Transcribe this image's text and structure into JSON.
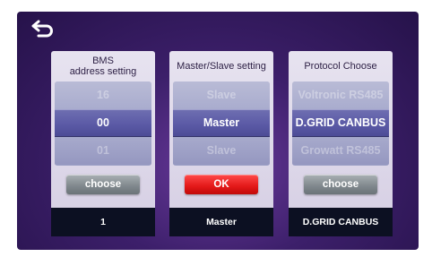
{
  "colors": {
    "screen_bg": "#3c1f6a",
    "ok_button": "#e31818",
    "choose_button": "#7f878c",
    "value_bar": "#0c1022",
    "selected_row": "#5b5aa6"
  },
  "back_icon": "back-arrow-icon",
  "panels": [
    {
      "title_line1": "BMS",
      "title_line2": "address setting",
      "rows": [
        "16",
        "00",
        "01"
      ],
      "button_label": "choose",
      "value": "1"
    },
    {
      "title_line1": "Master/Slave setting",
      "rows": [
        "Slave",
        "Master",
        "Slave"
      ],
      "button_label": "OK",
      "value": "Master"
    },
    {
      "title_line1": "Protocol Choose",
      "rows": [
        "Voltronic RS485",
        "D.GRID CANBUS",
        "Growatt RS485"
      ],
      "button_label": "choose",
      "value": "D.GRID CANBUS"
    }
  ]
}
